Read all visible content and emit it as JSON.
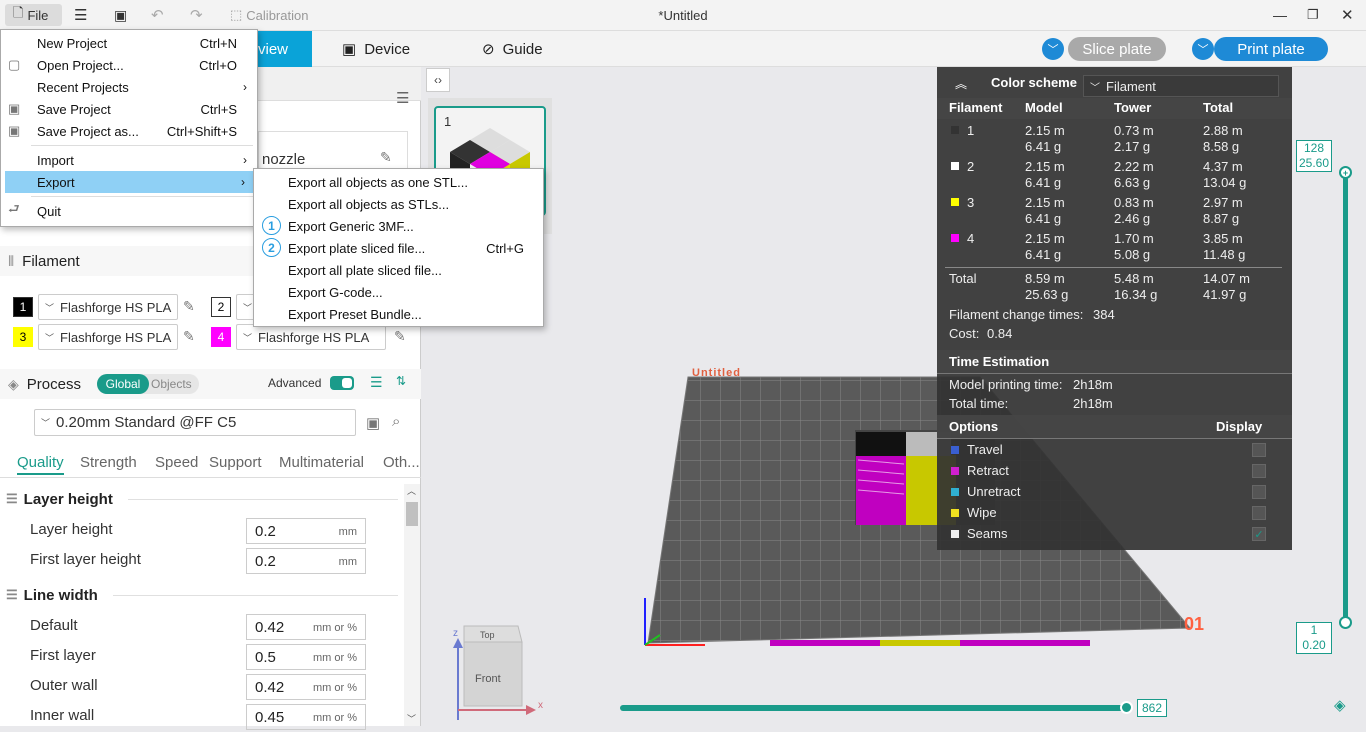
{
  "titlebar": {
    "file_label": "File",
    "calibration_label": "Calibration",
    "window_title": "*Untitled"
  },
  "tabs": {
    "preview_label": "view",
    "device_label": "Device",
    "guide_label": "Guide",
    "slice_label": "Slice plate",
    "print_label": "Print plate"
  },
  "file_menu": {
    "items": [
      {
        "label": "New Project",
        "shortcut": "Ctrl+N"
      },
      {
        "label": "Open Project...",
        "shortcut": "Ctrl+O"
      },
      {
        "label": "Recent Projects",
        "shortcut": ""
      },
      {
        "label": "Save Project",
        "shortcut": "Ctrl+S"
      },
      {
        "label": "Save Project as...",
        "shortcut": "Ctrl+Shift+S"
      },
      {
        "label": "Import",
        "shortcut": ""
      },
      {
        "label": "Export",
        "shortcut": ""
      },
      {
        "label": "Quit",
        "shortcut": ""
      }
    ]
  },
  "export_menu": {
    "items": [
      {
        "label": "Export all objects as one STL...",
        "shortcut": "",
        "badge": ""
      },
      {
        "label": "Export all objects as STLs...",
        "shortcut": "",
        "badge": ""
      },
      {
        "label": "Export Generic 3MF...",
        "shortcut": "",
        "badge": "1"
      },
      {
        "label": "Export plate sliced file...",
        "shortcut": "Ctrl+G",
        "badge": "2"
      },
      {
        "label": "Export all plate sliced file...",
        "shortcut": "",
        "badge": ""
      },
      {
        "label": "Export G-code...",
        "shortcut": "",
        "badge": ""
      },
      {
        "label": "Export Preset Bundle...",
        "shortcut": "",
        "badge": ""
      }
    ]
  },
  "left": {
    "nozzle_text": "nozzle",
    "filament_header": "Filament",
    "filaments": [
      {
        "num": "1",
        "name": "Flashforge HS PLA",
        "color": "#000000"
      },
      {
        "num": "2",
        "name": "",
        "color": "#ffffff"
      },
      {
        "num": "3",
        "name": "Flashforge HS PLA",
        "color": "#ffff00"
      },
      {
        "num": "4",
        "name": "Flashforge HS PLA",
        "color": "#ff00ff"
      }
    ],
    "process_header": "Process",
    "global_label": "Global",
    "objects_label": "Objects",
    "advanced_label": "Advanced",
    "preset": "0.20mm Standard @FF C5",
    "process_tabs": [
      "Quality",
      "Strength",
      "Speed",
      "Support",
      "Multimaterial",
      "Oth..."
    ],
    "groups": {
      "layer_height_title": "Layer height",
      "line_width_title": "Line width"
    },
    "settings": [
      {
        "label": "Layer height",
        "value": "0.2",
        "unit": "mm"
      },
      {
        "label": "First layer height",
        "value": "0.2",
        "unit": "mm"
      },
      {
        "label": "Default",
        "value": "0.42",
        "unit": "mm or %"
      },
      {
        "label": "First layer",
        "value": "0.5",
        "unit": "mm or %"
      },
      {
        "label": "Outer wall",
        "value": "0.42",
        "unit": "mm or %"
      },
      {
        "label": "Inner wall",
        "value": "0.45",
        "unit": "mm or %"
      }
    ]
  },
  "plate_thumb": {
    "number": "1"
  },
  "color_scheme": {
    "title": "Color scheme",
    "selected": "Filament",
    "headers": {
      "filament": "Filament",
      "model": "Model",
      "tower": "Tower",
      "total": "Total"
    },
    "rows": [
      {
        "id": "1",
        "color": "#333333",
        "model_m": "2.15 m",
        "model_g": "6.41 g",
        "tower_m": "0.73 m",
        "tower_g": "2.17 g",
        "total_m": "2.88 m",
        "total_g": "8.58 g"
      },
      {
        "id": "2",
        "color": "#ffffff",
        "model_m": "2.15 m",
        "model_g": "6.41 g",
        "tower_m": "2.22 m",
        "tower_g": "6.63 g",
        "total_m": "4.37 m",
        "total_g": "13.04 g"
      },
      {
        "id": "3",
        "color": "#ffff00",
        "model_m": "2.15 m",
        "model_g": "6.41 g",
        "tower_m": "0.83 m",
        "tower_g": "2.46 g",
        "total_m": "2.97 m",
        "total_g": "8.87 g"
      },
      {
        "id": "4",
        "color": "#ff00ff",
        "model_m": "2.15 m",
        "model_g": "6.41 g",
        "tower_m": "1.70 m",
        "tower_g": "5.08 g",
        "total_m": "3.85 m",
        "total_g": "11.48 g"
      }
    ],
    "total": {
      "label": "Total",
      "model_m": "8.59 m",
      "model_g": "25.63 g",
      "tower_m": "5.48 m",
      "tower_g": "16.34 g",
      "total_m": "14.07 m",
      "total_g": "41.97 g"
    },
    "change_label": "Filament change times:",
    "change_value": "384",
    "cost_label": "Cost:",
    "cost_value": "0.84",
    "time_header": "Time Estimation",
    "model_time_label": "Model printing time:",
    "model_time_value": "2h18m",
    "total_time_label": "Total time:",
    "total_time_value": "2h18m",
    "options_header": "Options",
    "display_header": "Display",
    "options": [
      {
        "label": "Travel",
        "color": "#3a5fd0",
        "checked": false
      },
      {
        "label": "Retract",
        "color": "#d020d0",
        "checked": false
      },
      {
        "label": "Unretract",
        "color": "#30b0d0",
        "checked": false
      },
      {
        "label": "Wipe",
        "color": "#f0e020",
        "checked": false
      },
      {
        "label": "Seams",
        "color": "#eeeeee",
        "checked": true
      }
    ]
  },
  "viewport": {
    "plate_label": "Untitled",
    "plate_number": "01",
    "layer_top": "128",
    "layer_top_height": "25.60",
    "layer_bottom": "1",
    "layer_bottom_height": "0.20",
    "move_value": "862",
    "axis_z": "z",
    "axis_x": "x",
    "cube_top": "Top",
    "cube_front": "Front"
  }
}
